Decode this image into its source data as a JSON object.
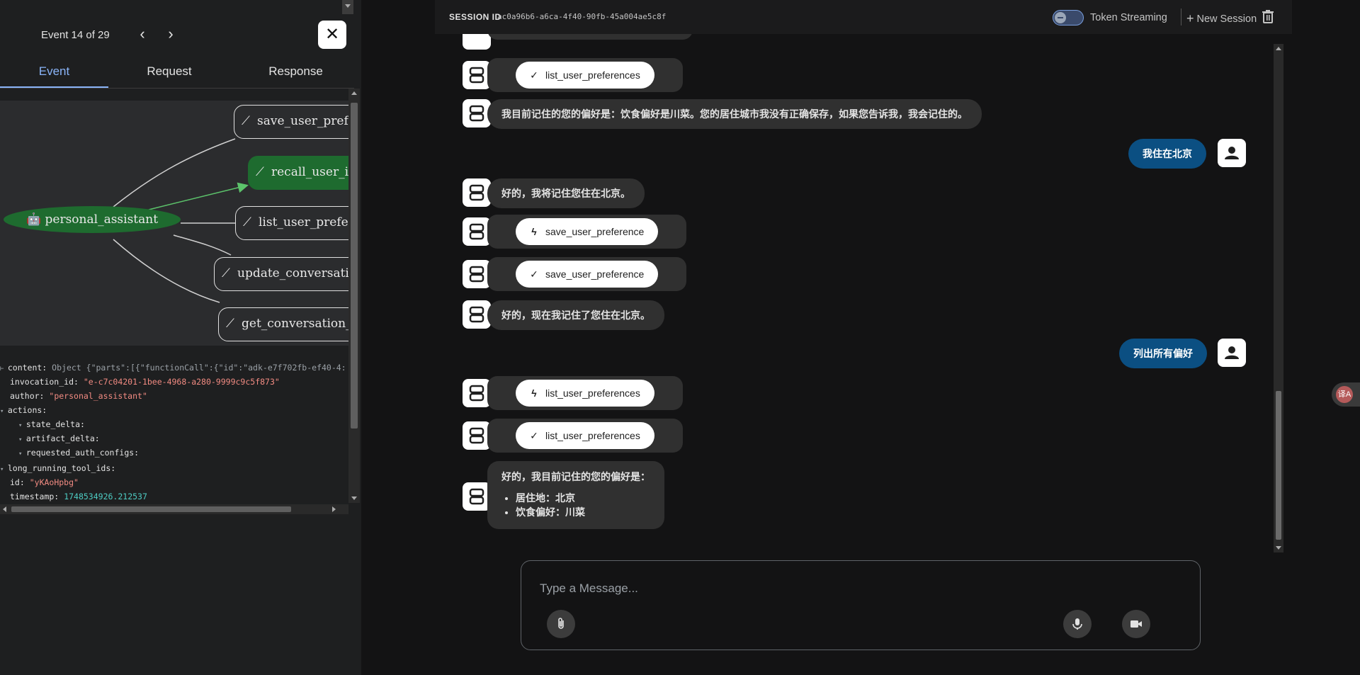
{
  "event_panel": {
    "counter": "Event 14 of 29",
    "prev_icon": "‹",
    "next_icon": "›",
    "close_icon": "✕",
    "tabs": [
      {
        "label": "Event",
        "active": true
      },
      {
        "label": "Request",
        "active": false
      },
      {
        "label": "Response",
        "active": false
      }
    ]
  },
  "graph": {
    "agent": "personal_assistant",
    "agent_icon": "robot-icon",
    "tools": [
      {
        "label": "save_user_prefere",
        "highlighted": false
      },
      {
        "label": "recall_user_in",
        "highlighted": true
      },
      {
        "label": "list_user_prefere",
        "highlighted": false
      },
      {
        "label": "update_conversation",
        "highlighted": false
      },
      {
        "label": "get_conversation_su",
        "highlighted": false
      }
    ]
  },
  "event_json": {
    "content_key": "content:",
    "content_type": "Object",
    "content_preview": "{\"parts\":[{\"functionCall\":{\"id\":\"adk-e7f702fb-ef40-4:",
    "invocation_id_key": "invocation_id:",
    "invocation_id_val": "\"e-c7c04201-1bee-4968-a280-9999c9c5f873\"",
    "author_key": "author:",
    "author_val": "\"personal_assistant\"",
    "actions_key": "actions:",
    "state_delta_key": "state_delta:",
    "artifact_delta_key": "artifact_delta:",
    "requested_auth_configs_key": "requested_auth_configs:",
    "long_running_key": "long_running_tool_ids:",
    "id_key": "id:",
    "id_val": "\"yKAoHpbg\"",
    "timestamp_key": "timestamp:",
    "timestamp_val": "1748534926.212537"
  },
  "topbar": {
    "session_label": "SESSION ID",
    "session_id": "ac0a96b6-a6ca-4f40-90fb-45a004ae5c8f",
    "token_streaming": "Token Streaming",
    "new_session": "New Session",
    "plus": "+"
  },
  "messages": {
    "m0": {
      "tool": "list_user_preferences",
      "icon": "check-icon"
    },
    "m1": "我目前记住的您的偏好是：饮食偏好是川菜。您的居住城市我没有正确保存，如果您告诉我，我会记住的。",
    "m2": "我住在北京",
    "m3": "好的，我将记住您住在北京。",
    "m4": {
      "tool": "save_user_preference",
      "icon": "bolt-icon"
    },
    "m5": {
      "tool": "save_user_preference",
      "icon": "check-icon"
    },
    "m6": "好的，现在我记住了您住在北京。",
    "m7": "列出所有偏好",
    "m8": {
      "tool": "list_user_preferences",
      "icon": "bolt-icon"
    },
    "m9": {
      "tool": "list_user_preferences",
      "icon": "check-icon"
    },
    "m10": {
      "intro": "好的，我目前记住的您的偏好是：",
      "items": [
        "居住地：北京",
        "饮食偏好：川菜"
      ]
    }
  },
  "composer": {
    "placeholder": "Type a Message..."
  },
  "translate_badge": "译A",
  "colors": {
    "accent_blue": "#8ab4f8",
    "user_bubble": "#0b4f82",
    "highlight_green": "#1e6b2f",
    "json_string": "#f28b82",
    "json_number": "#4ecdc4"
  }
}
